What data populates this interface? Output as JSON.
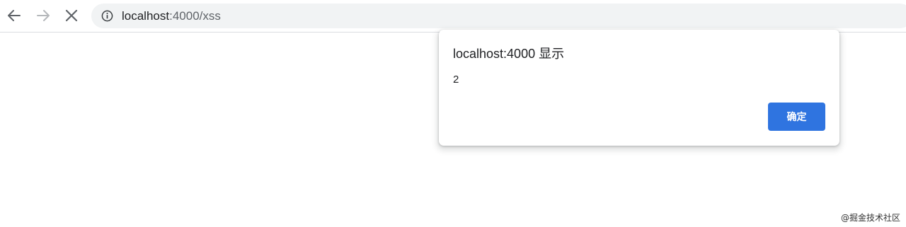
{
  "browser": {
    "toolbar": {
      "back_icon": "arrow-left-icon",
      "forward_icon": "arrow-right-icon",
      "stop_icon": "close-icon"
    },
    "omnibox": {
      "info_icon": "info-circle-icon",
      "host": "localhost",
      "path": ":4000/xss"
    }
  },
  "dialog": {
    "title": "localhost:4000 显示",
    "message": "2",
    "ok_label": "确定",
    "accent_color": "#2f74e0"
  },
  "watermark": {
    "text": "@掘金技术社区"
  }
}
